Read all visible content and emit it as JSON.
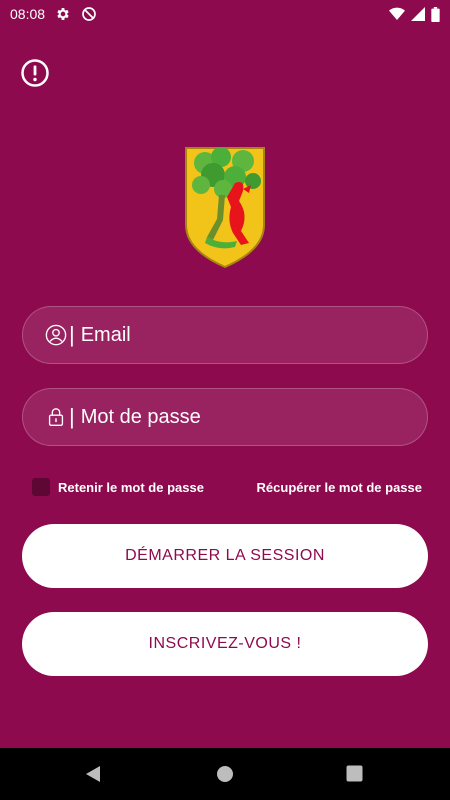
{
  "status_bar": {
    "time": "08:08",
    "icons": [
      "gear-icon",
      "do-not-disturb-icon",
      "wifi-icon",
      "signal-icon",
      "battery-icon"
    ]
  },
  "header": {
    "alert_icon": "exclamation-circle-icon"
  },
  "crest": {
    "icon": "coat-of-arms-shield",
    "colors": {
      "field": "#f2c318",
      "tree": "#4caf3a",
      "animal": "#e8141c"
    }
  },
  "form": {
    "email_placeholder": "Email",
    "email_value": "",
    "password_placeholder": "Mot de passe",
    "password_value": "",
    "separator": "|",
    "remember_checked": false,
    "remember_label": "Retenir le mot de passe",
    "recover_label": "Récupérer le mot de passe"
  },
  "buttons": {
    "login_label": "DÉMARRER LA SESSION",
    "signup_label": "INSCRIVEZ-VOUS !"
  },
  "theme": {
    "background": "#8e0a4f",
    "button_text": "#8e0a4f",
    "button_bg": "#ffffff"
  },
  "nav_bar": {
    "icons": [
      "back-icon",
      "home-icon",
      "recents-icon"
    ]
  }
}
